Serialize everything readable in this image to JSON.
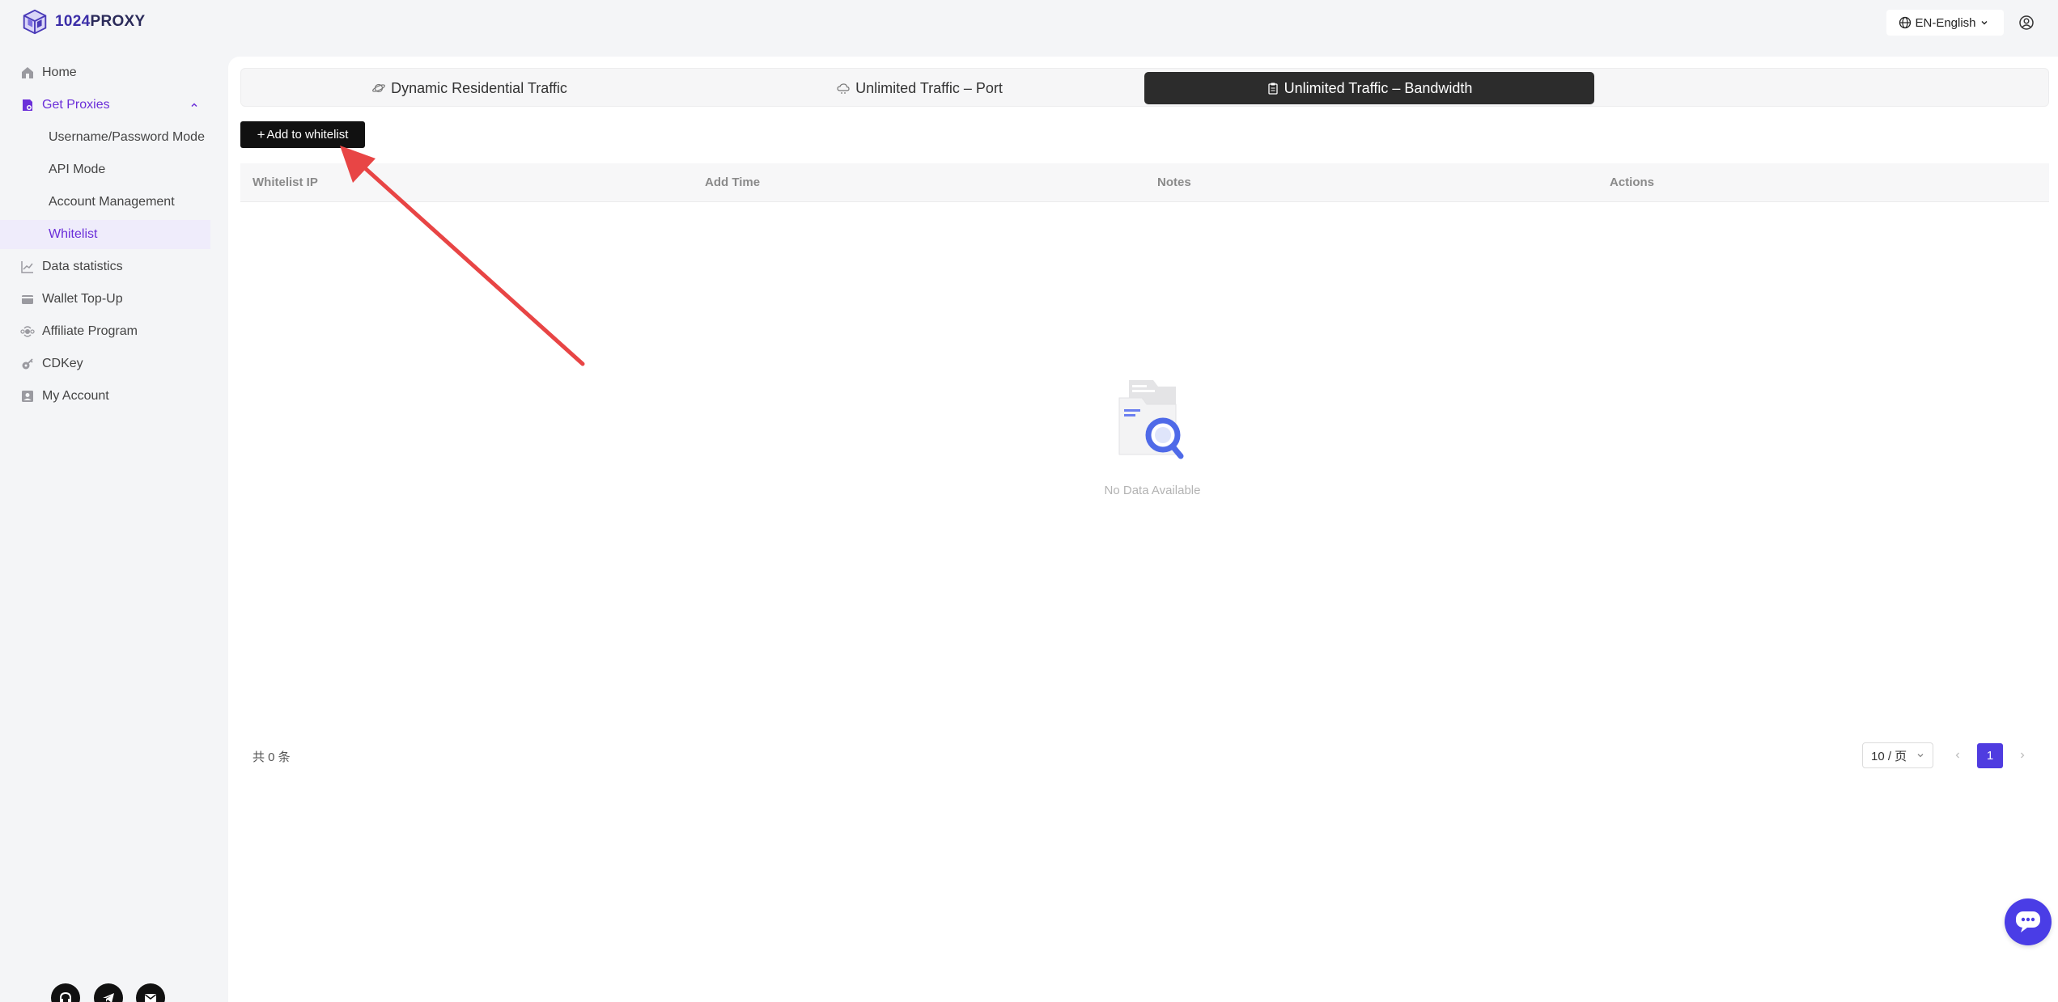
{
  "brand": {
    "name_a": "1024",
    "name_b": "PROXY"
  },
  "header": {
    "language": "EN-English"
  },
  "sidebar": {
    "home": "Home",
    "get_proxies": "Get Proxies",
    "sub_items": [
      "Username/Password Mode",
      "API Mode",
      "Account Management",
      "Whitelist"
    ],
    "active_sub": "Whitelist",
    "items": [
      "Data statistics",
      "Wallet Top-Up",
      "Affiliate Program",
      "CDKey",
      "My Account"
    ]
  },
  "tabs": [
    {
      "label": "Dynamic Residential Traffic"
    },
    {
      "label": "Unlimited Traffic – Port"
    },
    {
      "label": "Unlimited Traffic – Bandwidth"
    }
  ],
  "active_tab": "Unlimited Traffic – Bandwidth",
  "toolbar": {
    "add_label": "Add to whitelist"
  },
  "table": {
    "columns": [
      "Whitelist IP",
      "Add Time",
      "Notes",
      "Actions"
    ],
    "rows": [],
    "empty_text": "No Data Available"
  },
  "pagination": {
    "total_text": "共 0 条",
    "page_size": "10 / 页",
    "current_page": "1"
  },
  "colors": {
    "accent": "#6b2fd9",
    "primary_button": "#111111",
    "active_tab": "#2c2c2c",
    "page_active": "#4f3ce0",
    "annotation_arrow": "#e84545"
  }
}
